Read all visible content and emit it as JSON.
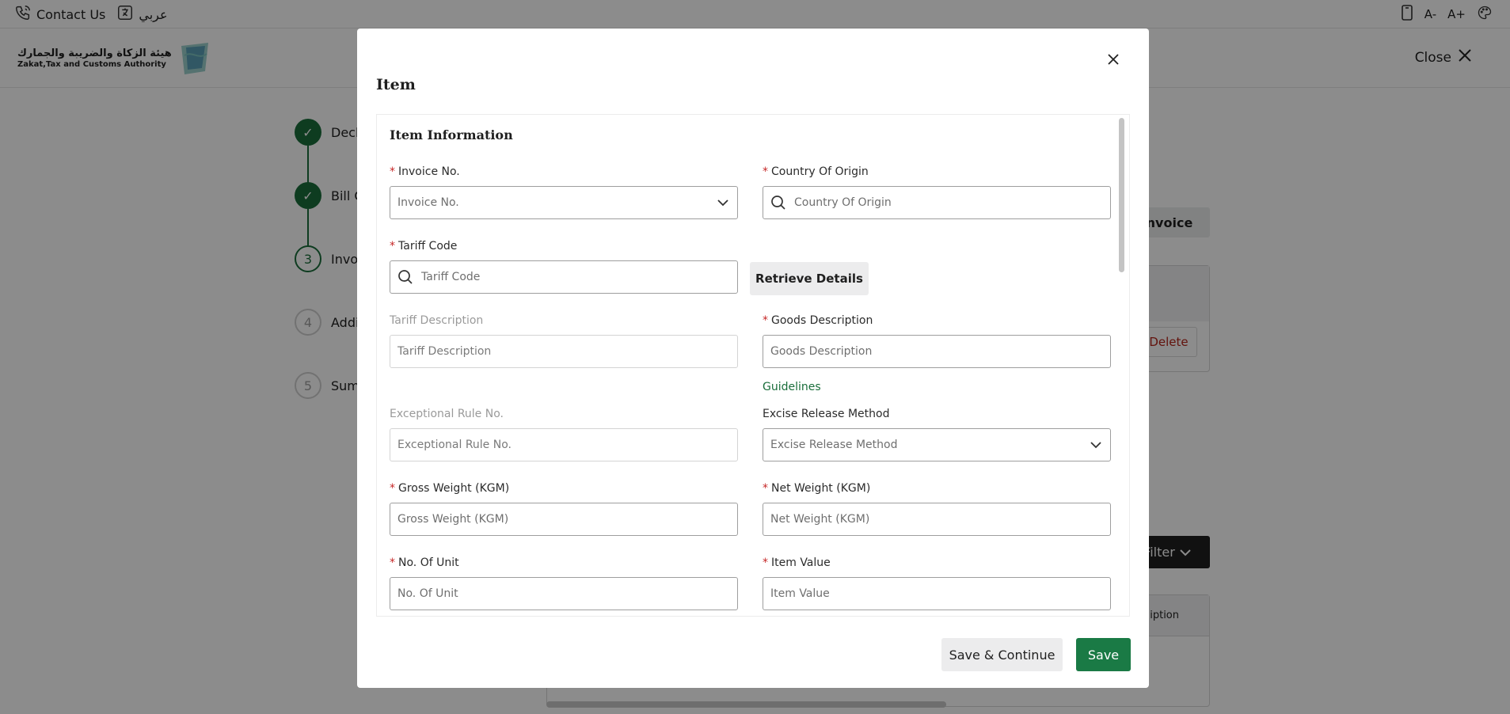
{
  "topbar": {
    "contact_label": "Contact Us",
    "language_label": "عربي",
    "icons": [
      "phone-call-icon",
      "translate-icon",
      "mobile-icon",
      "font-decrease-icon",
      "font-increase-icon",
      "palette-icon"
    ],
    "font_decrease": "A-",
    "font_increase": "A+"
  },
  "header": {
    "logo_ar": "هيئة الزكاة والضريبة والجمارك",
    "logo_en": "Zakat,Tax and Customs Authority",
    "close_label": "Close"
  },
  "stepper": {
    "steps": [
      {
        "marker": "✓",
        "label": "Decla",
        "state": "done"
      },
      {
        "marker": "✓",
        "label": "Bill C",
        "state": "done"
      },
      {
        "marker": "3",
        "label": "Invoi",
        "state": "current"
      },
      {
        "marker": "4",
        "label": "Additi",
        "state": "todo"
      },
      {
        "marker": "5",
        "label": "Sumr",
        "state": "todo"
      }
    ]
  },
  "background": {
    "invoice_button": "Invoice",
    "delete_button": "Delete",
    "filter_button": "Filter",
    "table_header_fragment": "iption"
  },
  "modal": {
    "title": "Item",
    "section_title": "Item Information",
    "fields": {
      "invoice_no": {
        "label": "Invoice No.",
        "placeholder": "Invoice No.",
        "required": true
      },
      "country_of_origin": {
        "label": "Country Of Origin",
        "placeholder": "Country Of Origin",
        "required": true
      },
      "tariff_code": {
        "label": "Tariff Code",
        "placeholder": "Tariff Code",
        "required": true
      },
      "tariff_description": {
        "label": "Tariff Description",
        "placeholder": "Tariff Description",
        "required": false
      },
      "goods_description": {
        "label": "Goods Description",
        "placeholder": "Goods Description",
        "required": true
      },
      "exceptional_rule_no": {
        "label": "Exceptional Rule No.",
        "placeholder": "Exceptional Rule No.",
        "required": false
      },
      "excise_release_method": {
        "label": "Excise Release Method",
        "placeholder": "Excise Release Method",
        "required": false
      },
      "gross_weight": {
        "label": "Gross Weight (KGM)",
        "placeholder": "Gross Weight (KGM)",
        "required": true
      },
      "net_weight": {
        "label": "Net Weight (KGM)",
        "placeholder": "Net Weight (KGM)",
        "required": true
      },
      "no_of_unit": {
        "label": "No. Of Unit",
        "placeholder": "No. Of Unit",
        "required": true
      },
      "item_value": {
        "label": "Item Value",
        "placeholder": "Item Value",
        "required": true
      }
    },
    "required_marker": "*",
    "retrieve_details_label": "Retrieve Details",
    "guidelines_label": "Guidelines",
    "save_continue_label": "Save & Continue",
    "save_label": "Save"
  },
  "colors": {
    "accent_green": "#1a7a45",
    "required_red": "#c62828",
    "overlay": "rgba(0,0,0,0.45)"
  }
}
